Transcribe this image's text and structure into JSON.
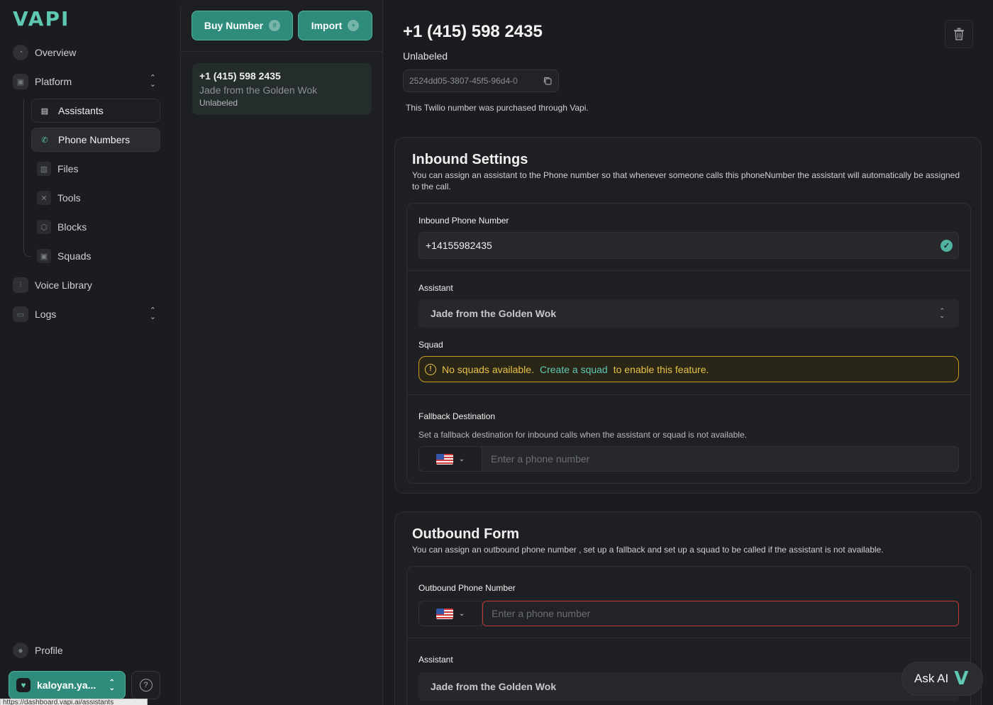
{
  "brand": {
    "logo_text": "VAPI",
    "accent": "#5ec8b3",
    "button_teal": "#2f8c7c"
  },
  "sidebar": {
    "top_items": [
      {
        "label": "Overview",
        "icon": "chart-pie-icon"
      },
      {
        "label": "Platform",
        "icon": "cpu-icon"
      }
    ],
    "platform_items": [
      {
        "label": "Assistants",
        "icon": "user-card-icon"
      },
      {
        "label": "Phone Numbers",
        "icon": "phone-icon"
      },
      {
        "label": "Files",
        "icon": "file-icon"
      },
      {
        "label": "Tools",
        "icon": "tools-icon"
      },
      {
        "label": "Blocks",
        "icon": "cube-icon"
      },
      {
        "label": "Squads",
        "icon": "squad-icon"
      }
    ],
    "bottom_items": [
      {
        "label": "Voice Library",
        "icon": "waveform-icon"
      },
      {
        "label": "Logs",
        "icon": "inbox-icon"
      }
    ],
    "profile_label": "Profile",
    "org_name": "kaloyan.ya...",
    "url_tooltip": "https://dashboard.vapi.ai/assistants"
  },
  "list": {
    "buy_label": "Buy Number",
    "import_label": "Import",
    "cards": [
      {
        "number": "+1 (415) 598 2435",
        "assistant": "Jade from the Golden Wok",
        "label": "Unlabeled"
      }
    ]
  },
  "detail": {
    "title": "+1 (415) 598 2435",
    "label": "Unlabeled",
    "id": "2524dd05-3807-45f5-96d4-0",
    "note": "This Twilio number was purchased through Vapi."
  },
  "inbound": {
    "title": "Inbound Settings",
    "description": "You can assign an assistant to the Phone number so that whenever someone calls this phoneNumber the assistant will automatically be assigned to the call.",
    "phone_label": "Inbound Phone Number",
    "phone_value": "+14155982435",
    "assistant_label": "Assistant",
    "assistant_value": "Jade from the Golden Wok",
    "squad_label": "Squad",
    "squad_warning_pre": "No squads available.",
    "squad_warning_link": "Create a squad",
    "squad_warning_post": "to enable this feature.",
    "fallback_label": "Fallback Destination",
    "fallback_help": "Set a fallback destination for inbound calls when the assistant or squad is not available.",
    "fallback_placeholder": "Enter a phone number"
  },
  "outbound": {
    "title": "Outbound Form",
    "description": "You can assign an outbound phone number , set up a fallback and set up a squad to be called if the assistant is not available.",
    "phone_label": "Outbound Phone Number",
    "phone_placeholder": "Enter a phone number",
    "assistant_label": "Assistant",
    "assistant_value": "Jade from the Golden Wok"
  },
  "ask_ai": {
    "label": "Ask AI"
  }
}
